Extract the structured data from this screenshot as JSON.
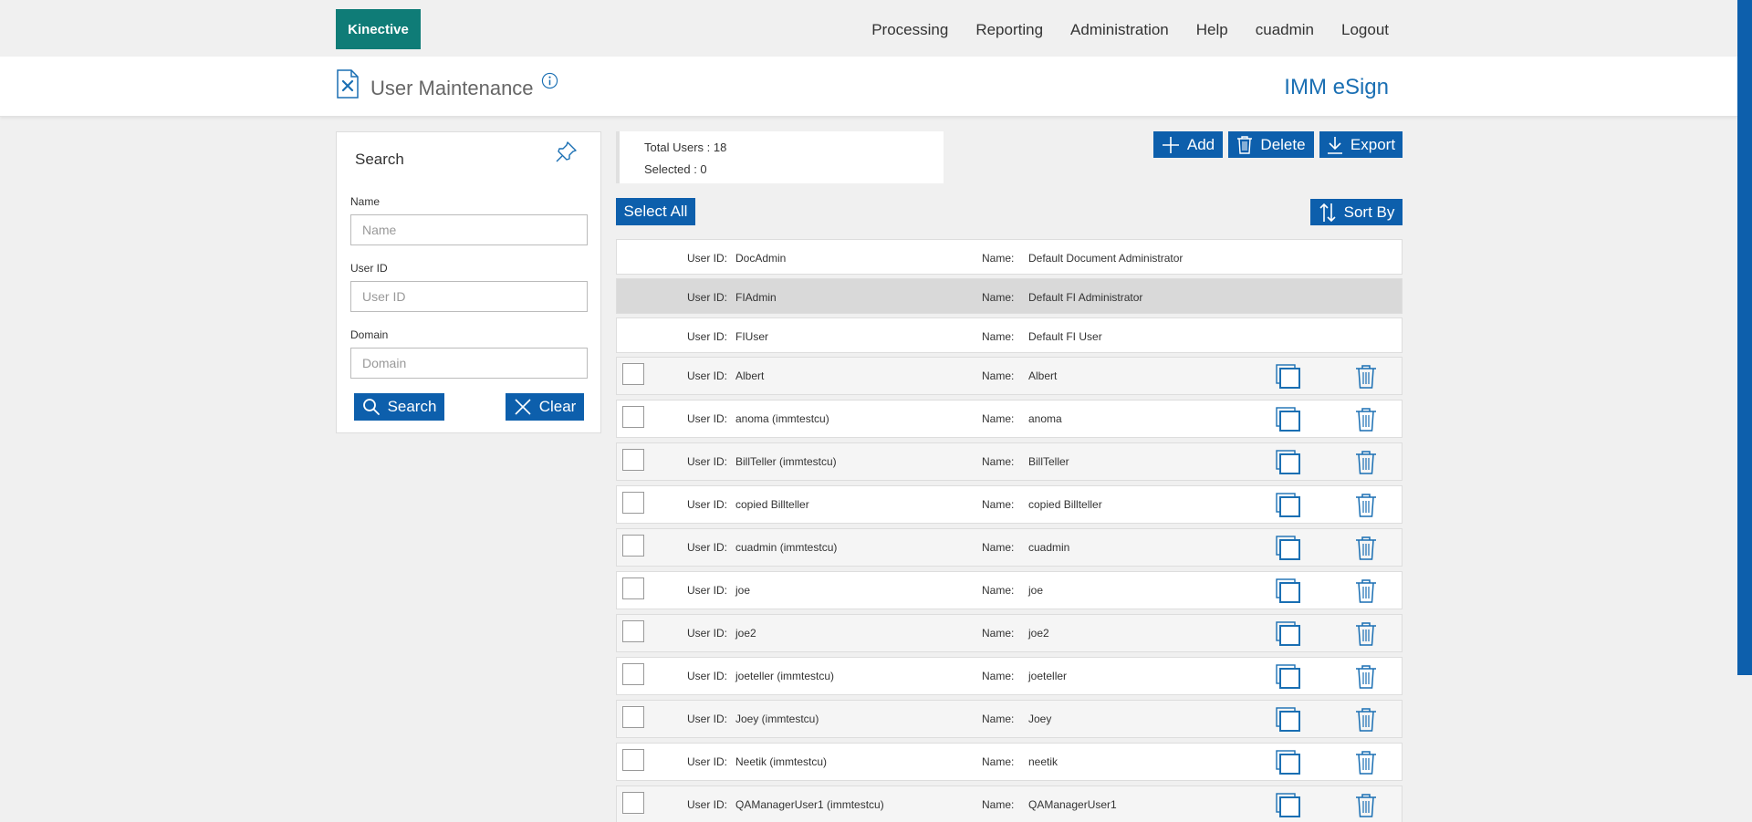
{
  "header": {
    "logo": "Kinective",
    "nav": [
      "Processing",
      "Reporting",
      "Administration",
      "Help",
      "cuadmin",
      "Logout"
    ]
  },
  "title": {
    "page_title": "User Maintenance",
    "app_name": "IMM eSign"
  },
  "search": {
    "heading": "Search",
    "name_label": "Name",
    "name_placeholder": "Name",
    "userid_label": "User ID",
    "userid_placeholder": "User ID",
    "domain_label": "Domain",
    "domain_placeholder": "Domain",
    "search_button": "Search",
    "clear_button": "Clear"
  },
  "summary": {
    "total": "Total Users : 18",
    "selected": "Selected : 0"
  },
  "toolbar": {
    "add": "Add",
    "delete": "Delete",
    "export": "Export",
    "select_all": "Select All",
    "sort_by": "Sort By"
  },
  "labels": {
    "user_id": "User ID:",
    "name": "Name:"
  },
  "users": [
    {
      "user_id": "DocAdmin",
      "name": "Default Document Administrator"
    },
    {
      "user_id": "FIAdmin",
      "name": "Default FI Administrator"
    },
    {
      "user_id": "FIUser",
      "name": "Default FI User"
    },
    {
      "user_id": "Albert",
      "name": "Albert"
    },
    {
      "user_id": "anoma (immtestcu)",
      "name": "anoma"
    },
    {
      "user_id": "BillTeller (immtestcu)",
      "name": "BillTeller"
    },
    {
      "user_id": "copied Billteller",
      "name": "copied Billteller"
    },
    {
      "user_id": "cuadmin (immtestcu)",
      "name": "cuadmin"
    },
    {
      "user_id": "joe",
      "name": "joe"
    },
    {
      "user_id": "joe2",
      "name": "joe2"
    },
    {
      "user_id": "joeteller (immtestcu)",
      "name": "joeteller"
    },
    {
      "user_id": "Joey (immtestcu)",
      "name": "Joey"
    },
    {
      "user_id": "Neetik (immtestcu)",
      "name": "neetik"
    },
    {
      "user_id": "QAManagerUser1 (immtestcu)",
      "name": "QAManagerUser1"
    }
  ],
  "colors": {
    "brand": "#0f7c77",
    "primary": "#0d5fac",
    "accent_text": "#1a6fb3"
  }
}
